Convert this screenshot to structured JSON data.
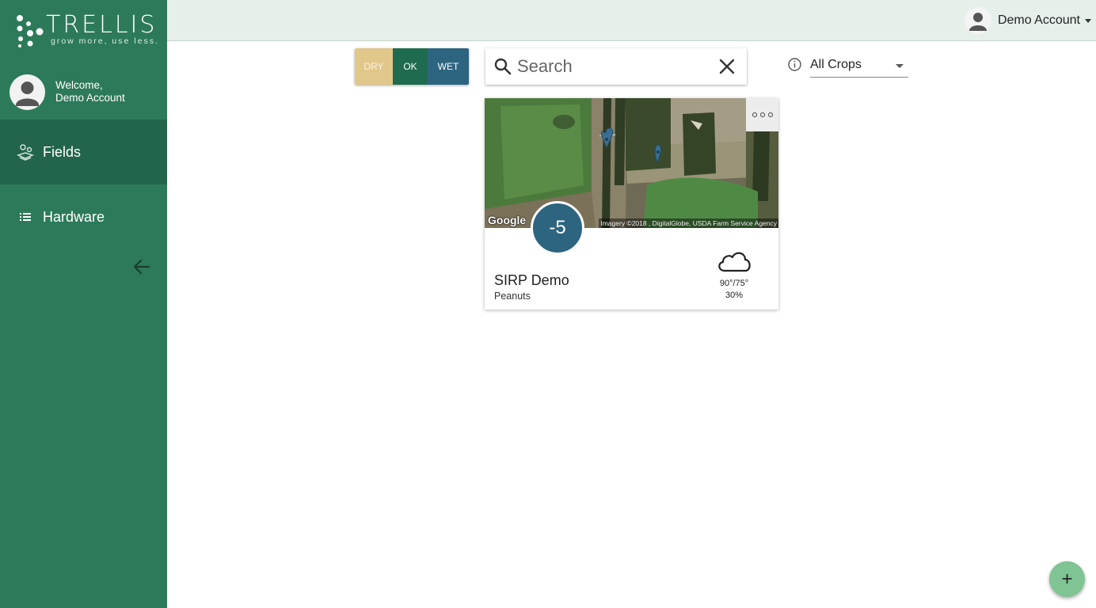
{
  "brand": {
    "name": "TRELLIS",
    "tagline": "grow more, use less."
  },
  "sidebar": {
    "welcome_line1": "Welcome,",
    "welcome_line2": "Demo Account",
    "items": [
      {
        "label": "Fields",
        "icon": "fields-map-icon",
        "active": true
      },
      {
        "label": "Hardware",
        "icon": "list-icon",
        "active": false
      }
    ],
    "collapse_icon": "arrow-left-icon"
  },
  "header": {
    "account_name": "Demo Account"
  },
  "status_toggle": {
    "options": [
      "DRY",
      "OK",
      "WET"
    ],
    "colors": {
      "dry": "#e2c78a",
      "ok": "#1f6b4f",
      "wet": "#2d6580"
    }
  },
  "search": {
    "placeholder": "Search",
    "value": ""
  },
  "crop_filter": {
    "selected": "All Crops"
  },
  "fields": [
    {
      "name": "SIRP Demo",
      "crop": "Peanuts",
      "score": "-5",
      "weather": {
        "temps": "90°/75°",
        "rain": "30%",
        "icon": "cloud-icon"
      },
      "map": {
        "provider": "Google",
        "attribution": "Imagery ©2018 , DigitalGlobe, USDA Farm Service Agency"
      }
    }
  ],
  "fab": {
    "label": "+"
  },
  "colors": {
    "sidebar": "#2d7a5a",
    "sidebar_active": "#22654a",
    "topbar": "#e7efeb",
    "score_badge": "#2d6580",
    "fab": "#7fc493"
  }
}
